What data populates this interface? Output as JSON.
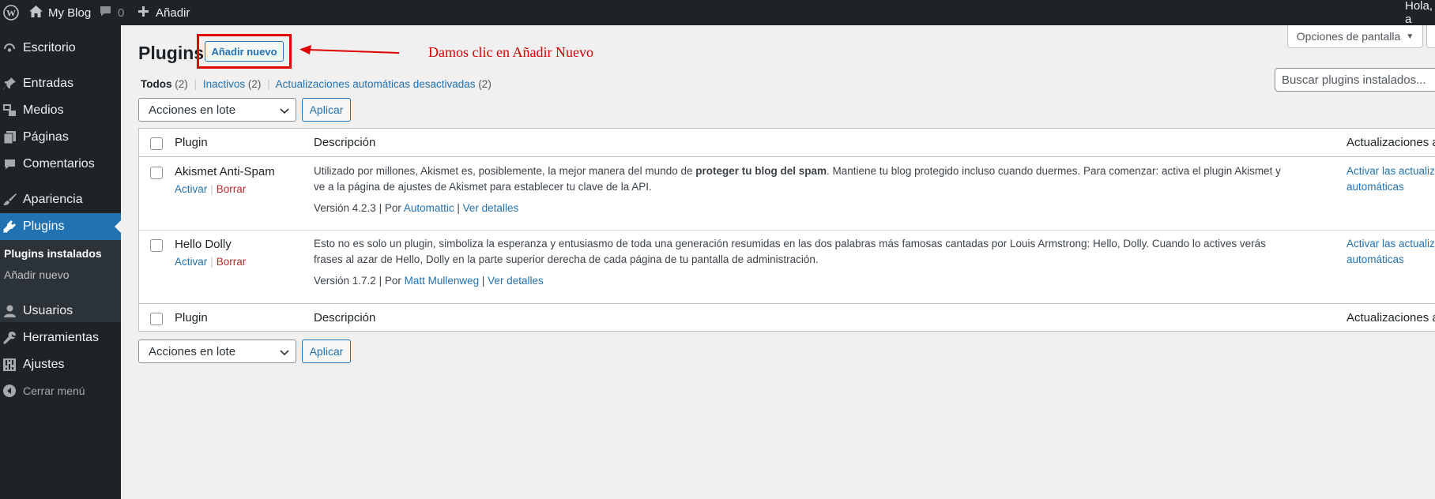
{
  "adminbar": {
    "site_name": "My Blog",
    "comments_count": "0",
    "new_label": "Añadir",
    "greeting": "Hola, a"
  },
  "sidebar": {
    "items": [
      {
        "label": "Escritorio",
        "icon": "dashboard-icon"
      },
      {
        "label": "Entradas",
        "icon": "pin-icon"
      },
      {
        "label": "Medios",
        "icon": "media-icon"
      },
      {
        "label": "Páginas",
        "icon": "page-icon"
      },
      {
        "label": "Comentarios",
        "icon": "comment-icon"
      },
      {
        "label": "Apariencia",
        "icon": "brush-icon"
      },
      {
        "label": "Plugins",
        "icon": "plugin-icon"
      },
      {
        "label": "Usuarios",
        "icon": "user-icon"
      },
      {
        "label": "Herramientas",
        "icon": "wrench-icon"
      },
      {
        "label": "Ajustes",
        "icon": "settings-icon"
      }
    ],
    "submenu": [
      "Plugins instalados",
      "Añadir nuevo"
    ],
    "collapse_label": "Cerrar menú"
  },
  "page": {
    "title": "Plugins",
    "add_new_label": "Añadir nuevo",
    "annotation": "Damos clic en Añadir Nuevo",
    "screen_options": "Opciones de pantalla",
    "search_placeholder": "Buscar plugins instalados...",
    "filters": {
      "all": "Todos",
      "all_count": "(2)",
      "inactive": "Inactivos",
      "inactive_count": "(2)",
      "auto_disabled": "Actualizaciones automáticas desactivadas",
      "auto_disabled_count": "(2)"
    },
    "bulk_actions": "Acciones en lote",
    "apply": "Aplicar"
  },
  "table": {
    "columns": [
      "Plugin",
      "Descripción",
      "Actualizaciones automáticas"
    ],
    "rows": [
      {
        "name": "Akismet Anti-Spam",
        "activate": "Activar",
        "delete": "Borrar",
        "desc_pre": "Utilizado por millones, Akismet es, posiblemente, la mejor manera del mundo de ",
        "desc_bold": "proteger tu blog del spam",
        "desc_post": ". Mantiene tu blog protegido incluso cuando duermes. Para comenzar: activa el plugin Akismet y ve a la página de ajustes de Akismet para establecer tu clave de la API.",
        "version": "Versión 4.2.3",
        "by": "Por",
        "author": "Automattic",
        "details": "Ver detalles",
        "auto_line1": "Activar las actualizaciones",
        "auto_line2": "automáticas"
      },
      {
        "name": "Hello Dolly",
        "activate": "Activar",
        "delete": "Borrar",
        "desc": "Esto no es solo un plugin, simboliza la esperanza y entusiasmo de toda una generación resumidas en las dos palabras más famosas cantadas por Louis Armstrong: Hello, Dolly. Cuando lo actives verás frases al azar de Hello, Dolly en la parte superior derecha de cada página de tu pantalla de administración.",
        "version": "Versión 1.7.2",
        "by": "Por",
        "author": "Matt Mullenweg",
        "details": "Ver detalles",
        "auto_line1": "Activar las actualizaciones",
        "auto_line2": "automáticas"
      }
    ]
  }
}
